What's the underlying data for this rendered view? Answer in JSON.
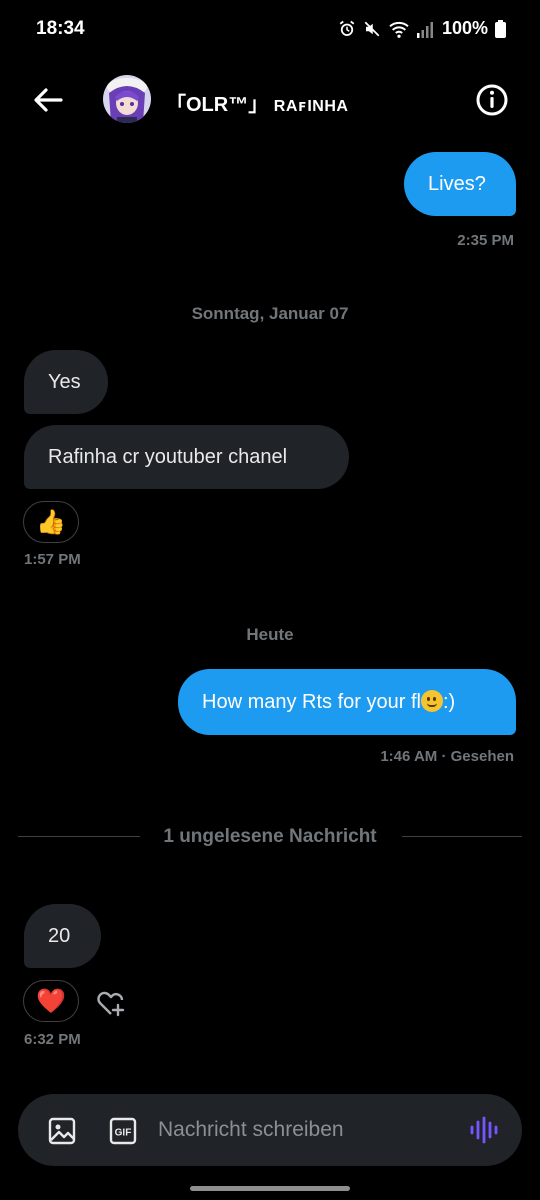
{
  "status_bar": {
    "time": "18:34",
    "battery": "100%",
    "icons": [
      "alarm-icon",
      "mute-icon",
      "wifi-icon",
      "signal-icon",
      "battery-icon"
    ]
  },
  "header": {
    "back_icon": "arrow-left-icon",
    "title_main": "「OLR™」",
    "title_name": "RAꜰINHA",
    "info_icon": "info-icon"
  },
  "messages": [
    {
      "direction": "out",
      "text": "Lives?",
      "time": "2:35 PM"
    },
    {
      "day_separator": "Sonntag, Januar 07"
    },
    {
      "direction": "in",
      "text": "Yes"
    },
    {
      "direction": "in",
      "text": "Rafinha cr youtuber chanel",
      "reaction": "👍",
      "time": "1:57 PM"
    },
    {
      "day_separator": "Heute"
    },
    {
      "direction": "out",
      "text_before": "How many Rts for your fl",
      "emoji": "melting-face",
      "text_after": ":)",
      "time": "1:46 AM · Gesehen"
    },
    {
      "unread_divider": "1 ungelesene Nachricht"
    },
    {
      "direction": "in",
      "text": "20",
      "reaction": "❤️",
      "time": "6:32 PM"
    }
  ],
  "composer": {
    "placeholder": "Nachricht schreiben",
    "gif_label": "GIF",
    "icons": [
      "image-icon",
      "gif-icon",
      "voice-message-icon"
    ]
  },
  "colors": {
    "background": "#000000",
    "outgoing_bubble": "#1d9bf0",
    "incoming_bubble": "#202327",
    "muted_text": "#71767b",
    "voice_icon": "#7856ff"
  }
}
